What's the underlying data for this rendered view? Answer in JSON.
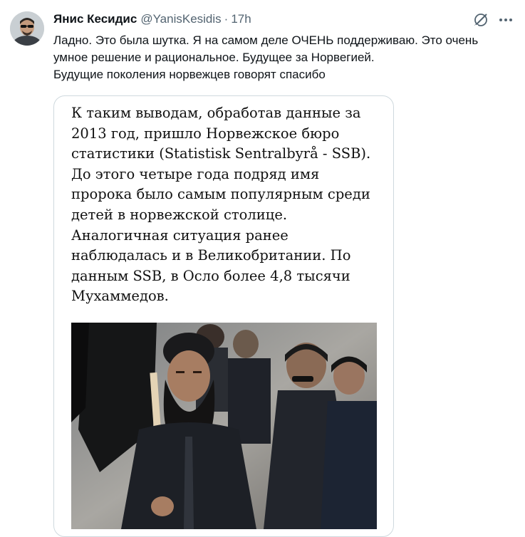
{
  "author": {
    "name": "Янис Кесидис",
    "handle": "@YanisKesidis",
    "separator": "·",
    "timestamp": "17h"
  },
  "icons": {
    "grok": "grok-icon",
    "more": "more-options-icon"
  },
  "tweet": {
    "text": "Ладно. Это была шутка. Я на самом деле ОЧЕНЬ поддерживаю. Это очень\nумное решение и рациональное. Будущее за Норвегией.\nБудущие поколения норвежцев говорят спасибо"
  },
  "media": {
    "article_text": "К таким выводам, обработав данные за\n2013 год, пришло Норвежское бюро\nстатистики (Statistisk Sentralbyrå - SSB).\nДо этого четыре года подряд имя\nпророка было самым популярным среди\nдетей в норвежской столице.\nАналогичная ситуация ранее\nнаблюдалась и в Великобритании. По\nданным SSB, в Осло более 4,8 тысячи\nМухаммедов."
  },
  "colors": {
    "text_primary": "#0f1419",
    "text_secondary": "#536471",
    "card_border": "#cfd9de"
  }
}
